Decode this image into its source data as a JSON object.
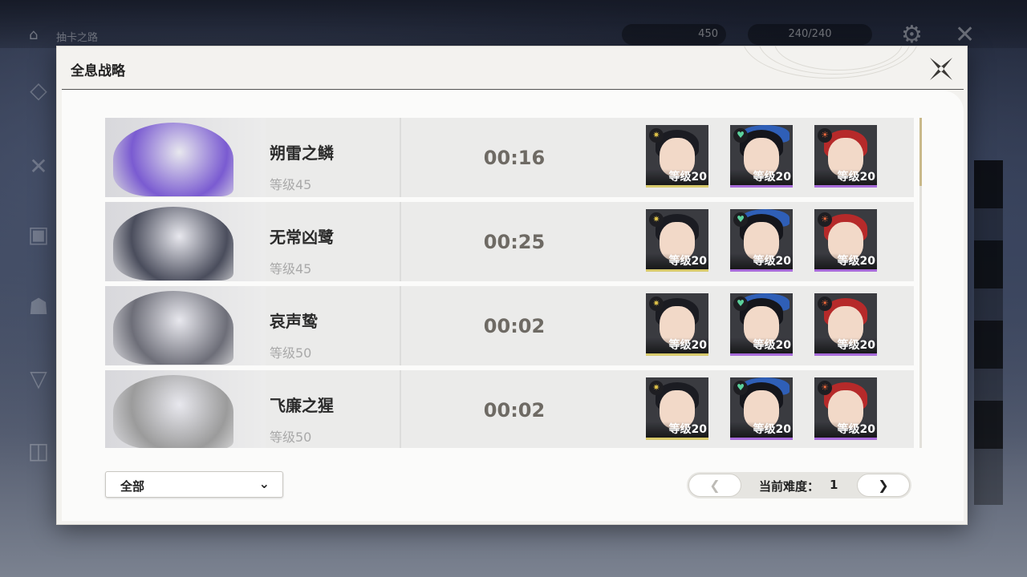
{
  "background": {
    "top_title": "抽卡之路",
    "resource_1": "450",
    "resource_2": "240/240"
  },
  "modal": {
    "title": "全息战略"
  },
  "rows": [
    {
      "name": "朔雷之鳞",
      "level": "等级45",
      "time": "00:16",
      "characters": [
        {
          "level": "等级20",
          "element_icon": "spectro-icon"
        },
        {
          "level": "等级20",
          "element_icon": "aero-icon"
        },
        {
          "level": "等级20",
          "element_icon": "fusion-icon"
        }
      ],
      "accent": "#7a5bd1"
    },
    {
      "name": "无常凶鹭",
      "level": "等级45",
      "time": "00:25",
      "characters": [
        {
          "level": "等级20",
          "element_icon": "spectro-icon"
        },
        {
          "level": "等级20",
          "element_icon": "aero-icon"
        },
        {
          "level": "等级20",
          "element_icon": "fusion-icon"
        }
      ],
      "accent": "#4a4d5c"
    },
    {
      "name": "哀声鸷",
      "level": "等级50",
      "time": "00:02",
      "characters": [
        {
          "level": "等级20",
          "element_icon": "spectro-icon"
        },
        {
          "level": "等级20",
          "element_icon": "aero-icon"
        },
        {
          "level": "等级20",
          "element_icon": "fusion-icon"
        }
      ],
      "accent": "#6d6e78"
    },
    {
      "name": "飞廉之猩",
      "level": "等级50",
      "time": "00:02",
      "characters": [
        {
          "level": "等级20",
          "element_icon": "spectro-icon"
        },
        {
          "level": "等级20",
          "element_icon": "aero-icon"
        },
        {
          "level": "等级20",
          "element_icon": "fusion-icon"
        }
      ],
      "accent": "#9b9b9b"
    }
  ],
  "filter": {
    "selected": "全部"
  },
  "pager": {
    "label": "当前难度：",
    "value": "1",
    "prev_symbol": "❮",
    "next_symbol": "❯"
  }
}
